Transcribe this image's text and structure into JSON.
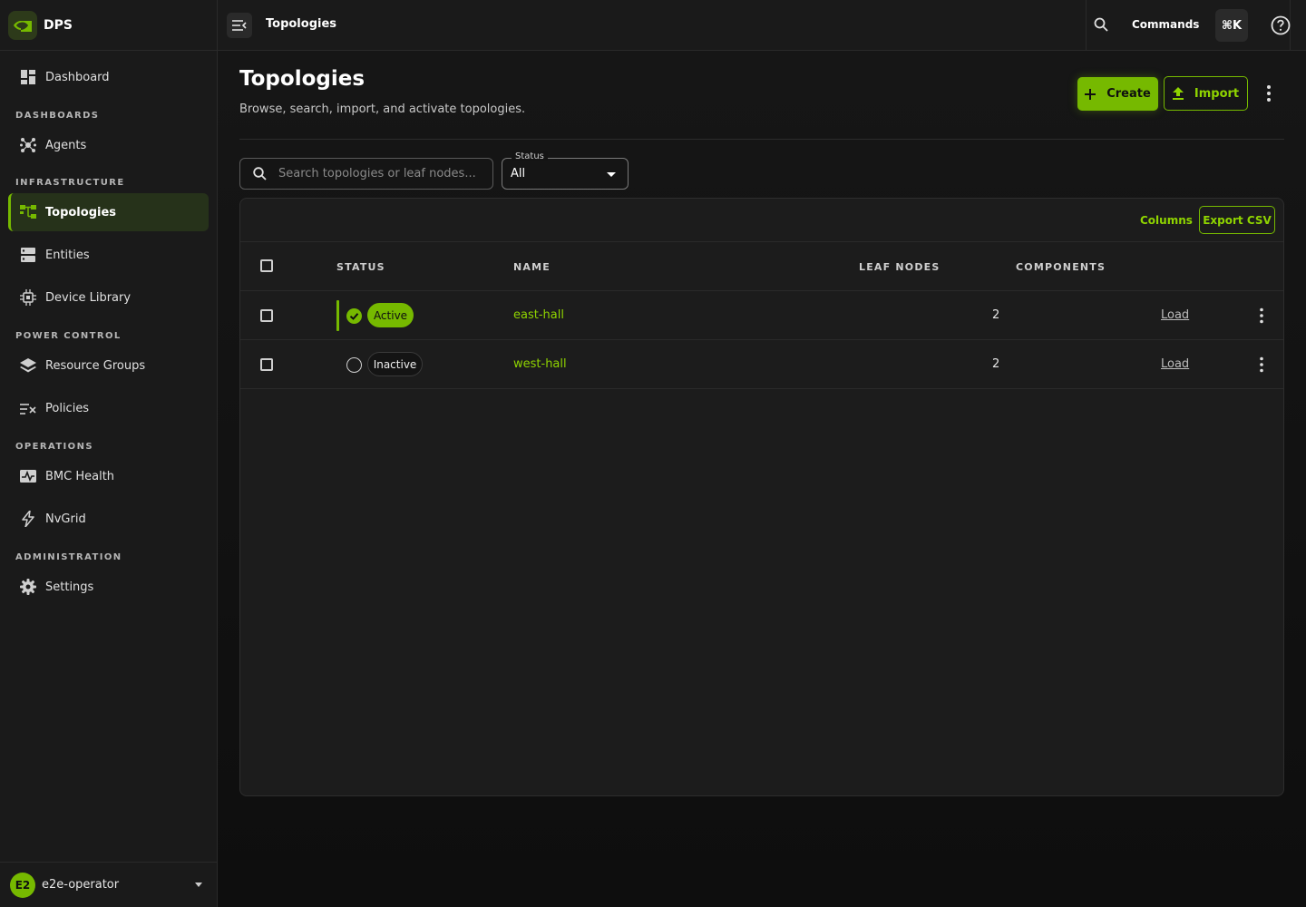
{
  "brand": {
    "name": "DPS"
  },
  "sidebar": {
    "items": [
      {
        "label": "Dashboard",
        "icon": "dashboard-icon"
      },
      {
        "label": "Agents",
        "icon": "agents-icon"
      },
      {
        "label": "Topologies",
        "icon": "topology-icon",
        "active": true
      },
      {
        "label": "Entities",
        "icon": "entities-icon"
      },
      {
        "label": "Device Library",
        "icon": "chip-icon"
      },
      {
        "label": "Resource Groups",
        "icon": "layers-icon"
      },
      {
        "label": "Policies",
        "icon": "policies-icon"
      },
      {
        "label": "BMC Health",
        "icon": "health-icon"
      },
      {
        "label": "NvGrid",
        "icon": "bolt-icon"
      },
      {
        "label": "Settings",
        "icon": "gear-icon"
      }
    ],
    "sections": [
      "DASHBOARDS",
      "INFRASTRUCTURE",
      "POWER CONTROL",
      "OPERATIONS",
      "ADMINISTRATION"
    ],
    "user": {
      "initials": "E2",
      "name": "e2e-operator"
    }
  },
  "topbar": {
    "title": "Topologies",
    "commands_label": "Commands",
    "shortcut": "⌘K"
  },
  "page": {
    "title": "Topologies",
    "subtitle": "Browse, search, import, and activate topologies.",
    "create_label": "Create",
    "import_label": "Import"
  },
  "filters": {
    "search_placeholder": "Search topologies or leaf nodes...",
    "status_label": "Status",
    "status_value": "All"
  },
  "table": {
    "columns_label": "Columns",
    "export_label": "Export CSV",
    "headers": [
      "STATUS",
      "NAME",
      "LEAF NODES",
      "COMPONENTS"
    ],
    "rows": [
      {
        "status": "Active",
        "name": "east-hall",
        "leaf_nodes": "2",
        "components": "Load"
      },
      {
        "status": "Inactive",
        "name": "west-hall",
        "leaf_nodes": "2",
        "components": "Load"
      }
    ]
  },
  "colors": {
    "accent": "#76b900",
    "background": "#0f0f0f",
    "surface": "#1c1c1c"
  }
}
